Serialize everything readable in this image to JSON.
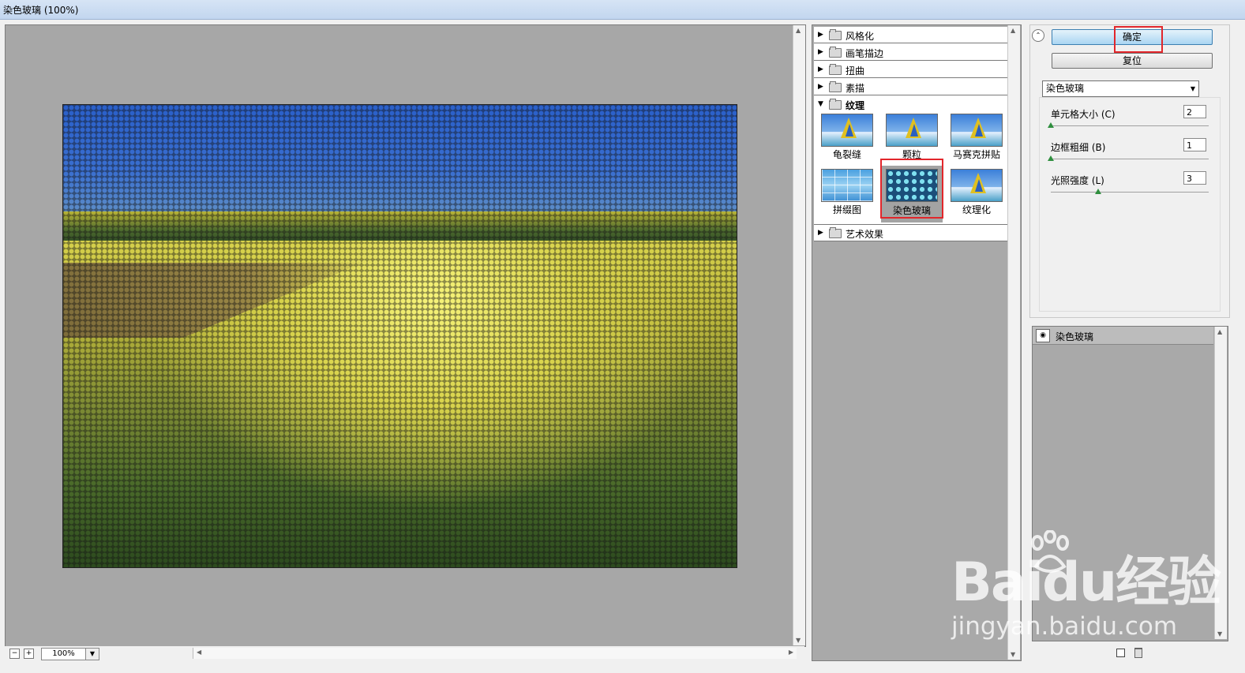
{
  "window": {
    "title": "染色玻璃 (100%)"
  },
  "preview": {
    "zoom": "100%"
  },
  "gallery": {
    "categories": [
      {
        "label": "风格化",
        "expanded": false
      },
      {
        "label": "画笔描边",
        "expanded": false
      },
      {
        "label": "扭曲",
        "expanded": false
      },
      {
        "label": "素描",
        "expanded": false
      },
      {
        "label": "纹理",
        "expanded": true
      },
      {
        "label": "艺术效果",
        "expanded": false
      }
    ],
    "texture_filters": [
      "龟裂缝",
      "颗粒",
      "马赛克拼贴",
      "拼缀图",
      "染色玻璃",
      "纹理化"
    ],
    "selected_filter": "染色玻璃"
  },
  "controls": {
    "ok_label": "确定",
    "reset_label": "复位",
    "filter_select": "染色玻璃",
    "params": [
      {
        "label": "单元格大小 (C)",
        "value": "2",
        "level_pct": 0
      },
      {
        "label": "边框粗细 (B)",
        "value": "1",
        "level_pct": 0
      },
      {
        "label": "光照强度 (L)",
        "value": "3",
        "level_pct": 30
      }
    ]
  },
  "layers": {
    "items": [
      {
        "label": "染色玻璃"
      }
    ]
  },
  "watermark": {
    "logo": "Baidu经验",
    "url": "jingyan.baidu.com"
  },
  "colors": {
    "highlight": "#e2262b",
    "accent": "#a9d5f2"
  }
}
